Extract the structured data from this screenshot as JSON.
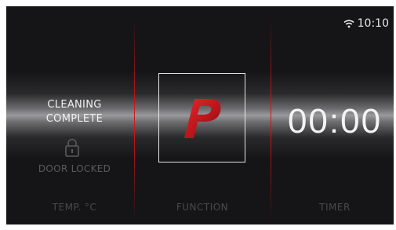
{
  "status": {
    "time": "10:10",
    "wifi_icon": "wifi-icon"
  },
  "left_panel": {
    "cleaning_line1": "CLEANING",
    "cleaning_line2": "COMPLETE",
    "lock_icon": "padlock-icon",
    "door_status": "DOOR LOCKED",
    "label": "TEMP. °C"
  },
  "center_panel": {
    "function_icon": "pyrolysis-p-icon",
    "label": "FUNCTION"
  },
  "right_panel": {
    "timer": "00:00",
    "label": "TIMER"
  },
  "colors": {
    "accent_red": "#c8171c",
    "background": "#151517",
    "text": "#f2f2f2",
    "dim_text": "#4a4a4d"
  }
}
